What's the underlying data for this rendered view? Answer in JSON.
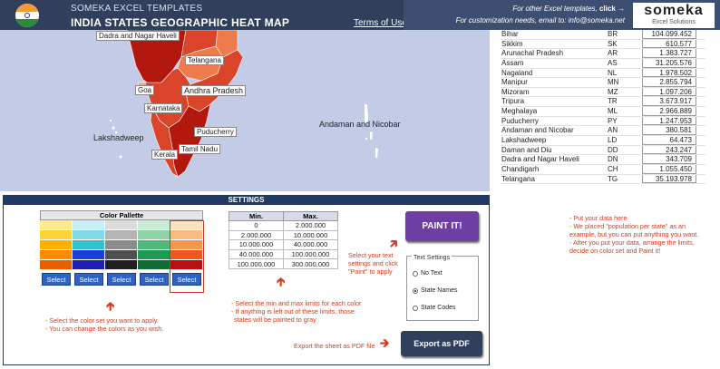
{
  "header": {
    "brand": "SOMEKA EXCEL TEMPLATES",
    "title": "INDIA STATES GEOGRAPHIC HEAT MAP",
    "terms_link": "Terms of Use",
    "other_templates_prefix": "For other Excel templates,",
    "other_templates_link": "click →",
    "customization": "For customization needs, email to: info@someka.net",
    "logo_main": "someka",
    "logo_sub": "Excel Solutions"
  },
  "map": {
    "labels": [
      {
        "key": "dnh",
        "text": "Dadra and Nagar Haveli"
      },
      {
        "key": "tg",
        "text": "Telangana"
      },
      {
        "key": "goa",
        "text": "Goa"
      },
      {
        "key": "ap",
        "text": "Andhra Pradesh"
      },
      {
        "key": "ka",
        "text": "Karnataka"
      },
      {
        "key": "py",
        "text": "Puducherry"
      },
      {
        "key": "tn",
        "text": "Tamil Nadu"
      },
      {
        "key": "kl",
        "text": "Kerala"
      },
      {
        "key": "ld",
        "text": "Lakshadweep"
      },
      {
        "key": "an",
        "text": "Andaman and Nicobar"
      }
    ],
    "colors": {
      "sea": "#c4cbe6",
      "dark": "#b2180d",
      "mid": "#d9442b",
      "light": "#ee7b4b",
      "pale": "#f5a672"
    }
  },
  "data_table": {
    "rows": [
      {
        "name": "Bihar",
        "code": "BR",
        "value": "104.099.452"
      },
      {
        "name": "Sikkim",
        "code": "SK",
        "value": "610.577"
      },
      {
        "name": "Arunachal Pradesh",
        "code": "AR",
        "value": "1.383.727"
      },
      {
        "name": "Assam",
        "code": "AS",
        "value": "31.205.576"
      },
      {
        "name": "Nagaland",
        "code": "NL",
        "value": "1.978.502"
      },
      {
        "name": "Manipur",
        "code": "MN",
        "value": "2.855.794"
      },
      {
        "name": "Mizoram",
        "code": "MZ",
        "value": "1.097.206"
      },
      {
        "name": "Tripura",
        "code": "TR",
        "value": "3.673.917"
      },
      {
        "name": "Meghalaya",
        "code": "ML",
        "value": "2.966.889"
      },
      {
        "name": "Puducherry",
        "code": "PY",
        "value": "1.247.953"
      },
      {
        "name": "Andaman and Nicobar",
        "code": "AN",
        "value": "380.581"
      },
      {
        "name": "Lakshadweep",
        "code": "LD",
        "value": "64.473"
      },
      {
        "name": "Daman and Diu",
        "code": "DD",
        "value": "243.247"
      },
      {
        "name": "Dadra and Nagar Haveli",
        "code": "DN",
        "value": "343.709"
      },
      {
        "name": "Chandigarh",
        "code": "CH",
        "value": "1.055.450"
      },
      {
        "name": "Telangana",
        "code": "TG",
        "value": "35.193.978"
      }
    ],
    "notes": [
      "- Put your data here",
      "- We placed \"population per state\" as an",
      "example, but you can put anything you want.",
      "- After you put your data, arrange the limits,",
      "decide on color set and Paint it!"
    ]
  },
  "settings": {
    "title": "SETTINGS",
    "palette": {
      "title": "Color Pallette",
      "columns": [
        [
          "#ffe98a",
          "#ffd235",
          "#ffb000",
          "#ff8c00",
          "#e66000"
        ],
        [
          "#c6eff7",
          "#7fdbe8",
          "#30c0cf",
          "#1b3fd0",
          "#2020b0"
        ],
        [
          "#dcdcdc",
          "#b4b4b4",
          "#8c8c8c",
          "#505050",
          "#202020"
        ],
        [
          "#c8ecd4",
          "#8fd4a6",
          "#4fb97a",
          "#1d9a52",
          "#106c34"
        ],
        [
          "#fde0c0",
          "#f9bb80",
          "#f5964c",
          "#ea5a20",
          "#b81010"
        ]
      ],
      "select_label": "Select",
      "notes": [
        "- Select the color set you want to apply.",
        "- You can change the colors as you wish."
      ]
    },
    "limits": {
      "min_header": "Min.",
      "max_header": "Max.",
      "rows": [
        {
          "min": "0",
          "max": "2.000.000"
        },
        {
          "min": "2.000.000",
          "max": "10.000.000"
        },
        {
          "min": "10.000.000",
          "max": "40.000.000"
        },
        {
          "min": "40.000.000",
          "max": "100.000.000"
        },
        {
          "min": "100.000.000",
          "max": "300.000.000"
        }
      ],
      "notes": [
        "- Select the min and max limits for each color",
        "- If anything is left out of these limits, those",
        "states will be painted to gray"
      ]
    },
    "paint": {
      "button": "PAINT IT!",
      "notes": [
        "Select your text",
        "settings and click",
        "\"Paint\" to apply"
      ]
    },
    "text_settings": {
      "title": "Text Settings",
      "options": [
        "No Text",
        "State Names",
        "State Codes"
      ],
      "selected": "State Names"
    },
    "pdf": {
      "note": "Export the sheet as PDF file",
      "button": "Export as PDF"
    }
  }
}
